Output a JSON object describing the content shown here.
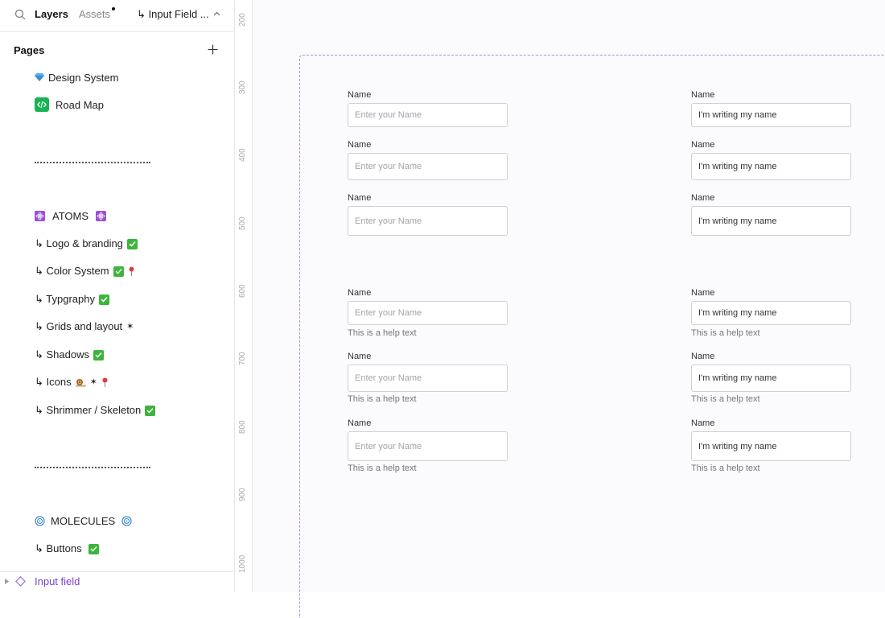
{
  "topbar": {
    "layers_tab": "Layers",
    "assets_tab": "Assets",
    "page_switcher": "↳ Input Field ..."
  },
  "pages": {
    "header": "Pages",
    "items": [
      {
        "label": "Design System"
      },
      {
        "label": "Road Map"
      },
      {
        "label": "ATOMS"
      },
      {
        "label": "↳ Logo & branding"
      },
      {
        "label": "↳ Color System"
      },
      {
        "label": "↳ Typgraphy"
      },
      {
        "label": "↳ Grids and layout"
      },
      {
        "label": "↳ Shadows"
      },
      {
        "label": "↳ Icons"
      },
      {
        "label": "↳ Shrimmer / Skeleton"
      },
      {
        "label": "MOLECULES"
      },
      {
        "label": "↳ Buttons"
      }
    ]
  },
  "layers": {
    "current_layer": "Input field"
  },
  "ruler": {
    "labels": [
      "200",
      "300",
      "400",
      "500",
      "600",
      "700",
      "800",
      "900",
      "1000"
    ]
  },
  "canvas": {
    "label": "Name",
    "placeholder": "Enter your Name",
    "filled_value": "I'm writing my name",
    "help_text": "This is a help text"
  },
  "colors": {
    "accent": "#7b3fd6",
    "frame_dash": "#b48ae8",
    "check_green": "#3bb53b",
    "code_green": "#1ab354"
  }
}
